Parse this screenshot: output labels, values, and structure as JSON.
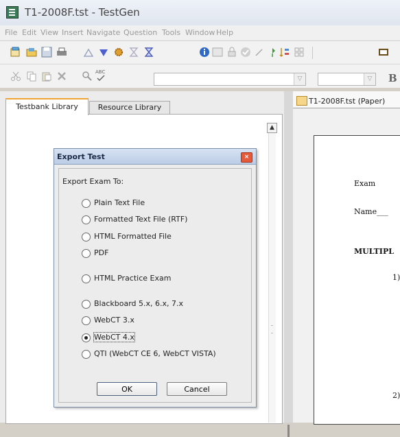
{
  "window": {
    "title": "T1-2008F.tst - TestGen"
  },
  "menu": [
    "File",
    "Edit",
    "View",
    "Insert",
    "Navigate",
    "Question",
    "Tools",
    "Window",
    "Help"
  ],
  "toolbar": {
    "icons": [
      "open-folder-icon",
      "folder-icon",
      "save-icon",
      "print-icon",
      "triangle-up-icon",
      "triangle-down-icon",
      "gear-icon",
      "hourglass-icon",
      "hourglass-icon",
      "info-icon",
      "grid-icon",
      "lock-icon",
      "check-circle-icon",
      "wand-icon",
      "pin-icon",
      "sort-icon",
      "grid-icon",
      "book-icon"
    ],
    "combo_a_value": "",
    "combo_b_value": "",
    "bold_label": "B",
    "spell_icon_label": "ABC"
  },
  "left_pane": {
    "tabs": [
      {
        "label": "Testbank Library",
        "active": true
      },
      {
        "label": "Resource Library",
        "active": false
      }
    ]
  },
  "doc_pane": {
    "tab_label": "T1-2008F.tst (Paper)",
    "lines": {
      "exam": "Exam",
      "name": "Name___",
      "section": "MULTIPL",
      "q1": "1)",
      "q2": "2)"
    }
  },
  "dialog": {
    "title": "Export Test",
    "close_glyph": "×",
    "label": "Export Exam To:",
    "options": [
      {
        "label": "Plain Text File",
        "selected": false
      },
      {
        "label": "Formatted Text File (RTF)",
        "selected": false
      },
      {
        "label": "HTML Formatted File",
        "selected": false
      },
      {
        "label": "PDF",
        "selected": false
      },
      {
        "label": "HTML Practice Exam",
        "selected": false
      },
      {
        "label": "Blackboard 5.x, 6.x, 7.x",
        "selected": false
      },
      {
        "label": "WebCT 3.x",
        "selected": false
      },
      {
        "label": "WebCT 4.x",
        "selected": true
      },
      {
        "label": "QTI (WebCT CE 6, WebCT VISTA)",
        "selected": false
      }
    ],
    "ok_label": "OK",
    "cancel_label": "Cancel"
  }
}
